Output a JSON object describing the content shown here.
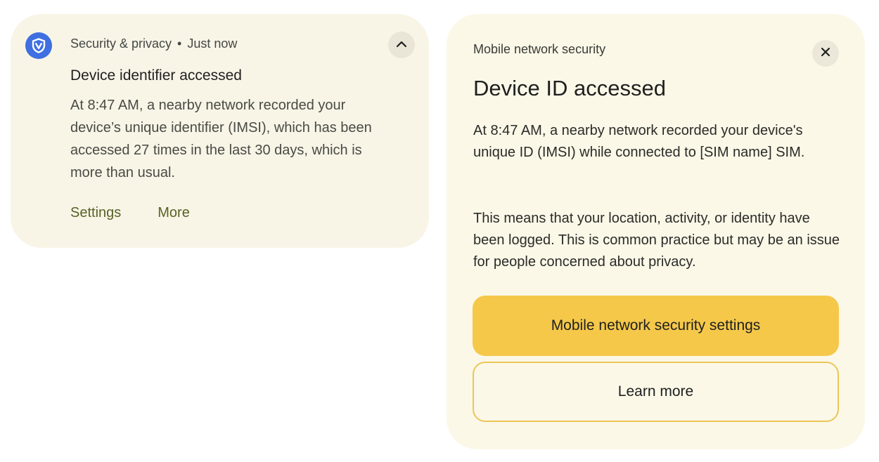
{
  "notification": {
    "app_icon": "shield-icon",
    "app_name": "Security & privacy",
    "separator": "•",
    "time": "Just now",
    "collapse_icon": "chevron-up-icon",
    "title": "Device identifier accessed",
    "body": "At 8:47 AM, a nearby network recorded your device’s unique identifier (IMSI), which has been accessed 27 times in the last 30 days, which is more than usual.",
    "actions": {
      "settings": "Settings",
      "more": "More"
    }
  },
  "dialog": {
    "overline": "Mobile network security",
    "close_icon": "close-icon",
    "title": "Device ID accessed",
    "paragraph1": "At 8:47 AM, a nearby network recorded your device's unique ID (IMSI) while connected to [SIM name] SIM.",
    "paragraph2": "This means that your location, activity, or identity have been logged. This is common practice but may be an issue for people concerned about privacy.",
    "primary_button": "Mobile network security settings",
    "secondary_button": "Learn more"
  },
  "colors": {
    "card_background": "#f8f5e7",
    "app_icon_blue": "#3f6fe0",
    "action_text": "#5a6125",
    "primary_button": "#f5c84a",
    "secondary_border": "#ecc655"
  }
}
